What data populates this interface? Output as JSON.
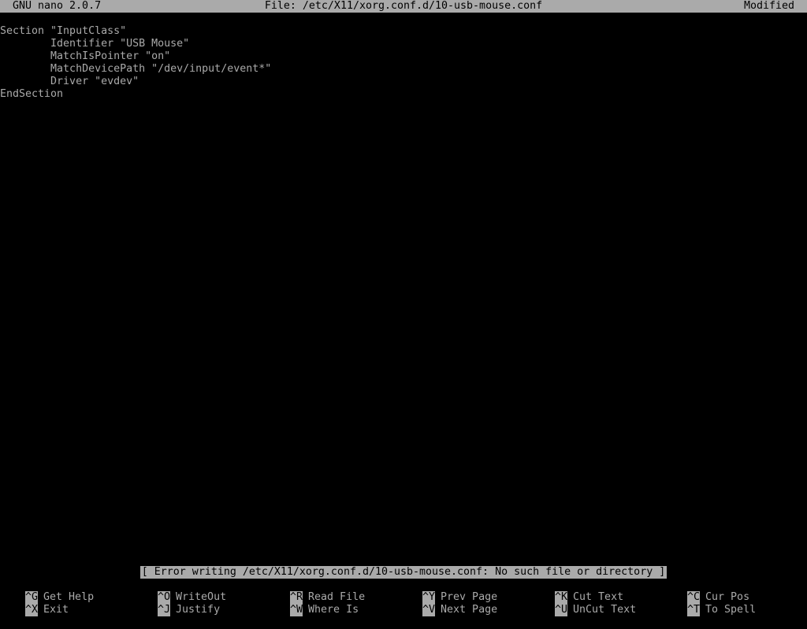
{
  "titlebar": {
    "app": "GNU nano 2.0.7",
    "file": "File: /etc/X11/xorg.conf.d/10-usb-mouse.conf",
    "status": "Modified"
  },
  "editor": {
    "lines": [
      "Section \"InputClass\"",
      "        Identifier \"USB Mouse\"",
      "        MatchIsPointer \"on\"",
      "        MatchDevicePath \"/dev/input/event*\"",
      "        Driver \"evdev\"",
      "EndSection"
    ]
  },
  "statusbar": {
    "message": "[ Error writing /etc/X11/xorg.conf.d/10-usb-mouse.conf: No such file or directory ]"
  },
  "shortcuts": {
    "row1": [
      {
        "key": "^G",
        "label": "Get Help"
      },
      {
        "key": "^O",
        "label": "WriteOut"
      },
      {
        "key": "^R",
        "label": "Read File"
      },
      {
        "key": "^Y",
        "label": "Prev Page"
      },
      {
        "key": "^K",
        "label": "Cut Text"
      },
      {
        "key": "^C",
        "label": "Cur Pos"
      }
    ],
    "row2": [
      {
        "key": "^X",
        "label": "Exit"
      },
      {
        "key": "^J",
        "label": "Justify"
      },
      {
        "key": "^W",
        "label": "Where Is"
      },
      {
        "key": "^V",
        "label": "Next Page"
      },
      {
        "key": "^U",
        "label": "UnCut Text"
      },
      {
        "key": "^T",
        "label": "To Spell"
      }
    ]
  },
  "colors": {
    "background": "#000000",
    "foreground": "#aaaaaa",
    "inverse_bg": "#aaaaaa",
    "inverse_fg": "#000000"
  }
}
